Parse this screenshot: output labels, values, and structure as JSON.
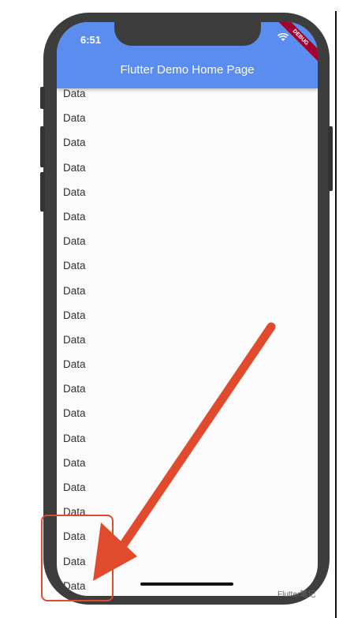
{
  "status_bar": {
    "time": "6:51"
  },
  "app_bar": {
    "title": "Flutter Demo Home Page",
    "debug_banner": "DEBUG"
  },
  "list": {
    "items": [
      "Data",
      "Data",
      "Data",
      "Data",
      "Data",
      "Data",
      "Data",
      "Data",
      "Data",
      "Data",
      "Data",
      "Data",
      "Data",
      "Data",
      "Data",
      "Data",
      "Data",
      "Data",
      "Data",
      "Data",
      "Data"
    ]
  },
  "fab": {
    "label": "+",
    "color": "#4d82e8"
  },
  "annotation": {
    "color": "#e04a2d"
  },
  "watermark": {
    "text": "Flutter笔记"
  },
  "colors": {
    "appbar": "#5b8def",
    "frame": "#3d3d3d",
    "debug": "#a3002b"
  }
}
